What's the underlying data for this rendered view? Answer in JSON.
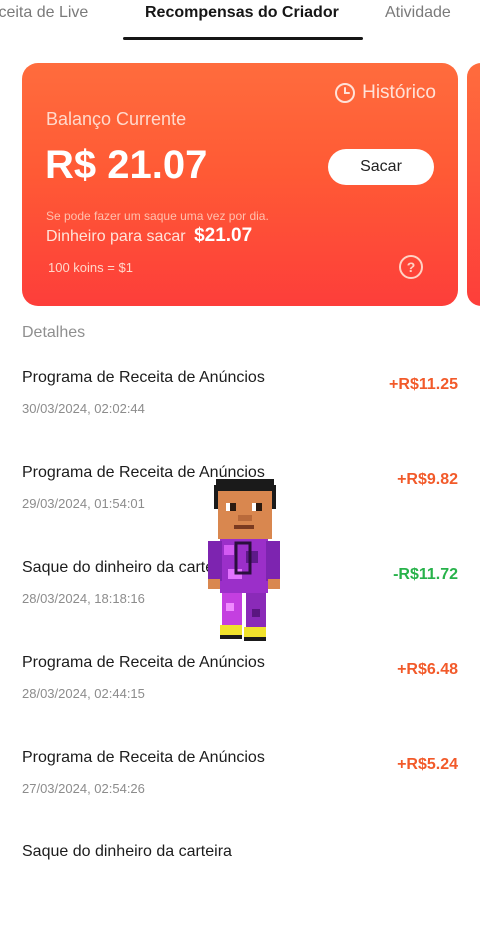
{
  "tabs": [
    {
      "label": "Receita de Live"
    },
    {
      "label": "Recompensas do Criador"
    },
    {
      "label": "Atividade"
    }
  ],
  "card": {
    "history_label": "Histórico",
    "history_icon": "clock-icon",
    "balance_label": "Balanço Currente",
    "balance_value": "R$ 21.07",
    "withdraw_label": "Sacar",
    "note": "Se pode fazer um saque uma vez por dia.",
    "cash_label": "Dinheiro para sacar",
    "cash_value": "$21.07",
    "rate": "100 koins = $1",
    "help_icon": "question-icon"
  },
  "details": {
    "heading": "Detalhes",
    "rows": [
      {
        "title": "Programa de Receita de Anúncios",
        "date": "30/03/2024, 02:02:44",
        "amount": "+R$11.25",
        "type": "pos"
      },
      {
        "title": "Programa de Receita de Anúncios",
        "date": "29/03/2024, 01:54:01",
        "amount": "+R$9.82",
        "type": "pos"
      },
      {
        "title": "Saque do dinheiro da carteira",
        "date": "28/03/2024, 18:18:16",
        "amount": "-R$11.72",
        "type": "neg"
      },
      {
        "title": "Programa de Receita de Anúncios",
        "date": "28/03/2024, 02:44:15",
        "amount": "+R$6.48",
        "type": "pos"
      },
      {
        "title": "Programa de Receita de Anúncios",
        "date": "27/03/2024, 02:54:26",
        "amount": "+R$5.24",
        "type": "pos"
      },
      {
        "title": "Saque do dinheiro da carteira",
        "date": "",
        "amount": "",
        "type": "neg"
      }
    ]
  },
  "colors": {
    "card_top": "#ff6c3d",
    "card_bottom": "#fd3e3a",
    "positive": "#f25a2a",
    "negative": "#27b24a"
  }
}
